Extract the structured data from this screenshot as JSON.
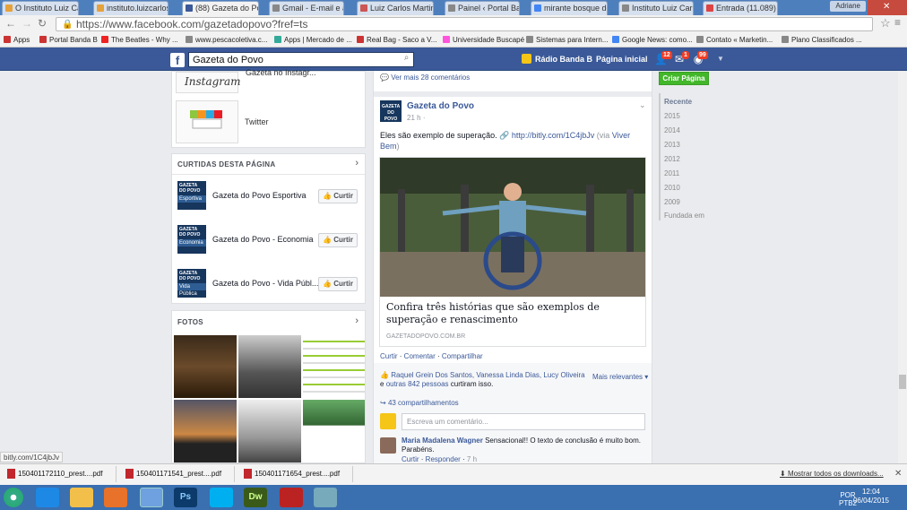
{
  "browser": {
    "tabs": [
      {
        "label": "O Instituto Luiz Ca",
        "color": "#e6a23c"
      },
      {
        "label": "instituto.luizcarlos",
        "color": "#e6a23c"
      },
      {
        "label": "(88) Gazeta do Po",
        "color": "#3b5998"
      },
      {
        "label": "Gmail - E-mail e ac",
        "color": "#888"
      },
      {
        "label": "Luiz Carlos Martin",
        "color": "#c55"
      },
      {
        "label": "Painel ‹ Portal Ban",
        "color": "#888"
      },
      {
        "label": "mirante bosque do",
        "color": "#4285f4"
      },
      {
        "label": "Instituto Luiz Carlo",
        "color": "#888"
      },
      {
        "label": "Entrada (11.089) -",
        "color": "#d44"
      }
    ],
    "user": "Adriane",
    "url": "https://www.facebook.com/gazetadopovo?fref=ts",
    "bookmarks": [
      "Apps",
      "Portal Banda B",
      "The Beatles - Why ...",
      "www.pescacoletiva.c...",
      "Apps | Mercado de ...",
      "Real Bag - Saco a V...",
      "Universidade Buscapé",
      "Sistemas para Intern...",
      "Google News: como...",
      "Contato « Marketin...",
      "Plano Classificados ..."
    ]
  },
  "fb": {
    "logo": "f",
    "search_value": "Gazeta do Povo",
    "nav_radio": "Rádio Banda B",
    "nav_home": "Página inicial",
    "badge_friends": "12",
    "badge_messages": "1",
    "badge_notifications": "99"
  },
  "left": {
    "instagram_label": "Instagram",
    "instagram_sub": "Gazeta no Instagr...",
    "twitter_label": "Twitter",
    "liked_title": "CURTIDAS DESTA PÁGINA",
    "liked_pages": [
      {
        "name": "Gazeta do Povo Esportiva",
        "thumb_top": "GAZETA DO POVO",
        "thumb_strip": "Esportiva"
      },
      {
        "name": "Gazeta do Povo - Economia",
        "thumb_top": "GAZETA DO POVO",
        "thumb_strip": "Economia"
      },
      {
        "name": "Gazeta do Povo - Vida Públ...",
        "thumb_top": "GAZETA DO POVO",
        "thumb_strip": "Vida Pública"
      }
    ],
    "curtir_label": "Curtir",
    "photos_title": "FOTOS"
  },
  "post": {
    "more_comments": "Ver mais 28 comentários",
    "page_name": "Gazeta do Povo",
    "avatar_text": "GAZETA DO POVO",
    "time": "21 h",
    "text_prefix": "Eles são exemplo de superação.",
    "link_url": "http://bitly.com/1C4jbJv",
    "via_open": "(via",
    "via_name": "Viver Bem",
    "via_close": ")",
    "link_title": "Confira três histórias que são exemplos de superação e renascimento",
    "link_domain": "GAZETADOPOVO.COM.BR",
    "action_like": "Curtir",
    "action_comment": "Comentar",
    "action_share": "Compartilhar",
    "likers": "Raquel Grein Dos Santos, Vanessa Linda Dias, Lucy Oliveira",
    "likers_and": "e",
    "likers_others": "outras 842 pessoas",
    "likers_suffix": "curtiram isso.",
    "sort_label": "Mais relevantes",
    "shares": "43 compartilhamentos",
    "comment_placeholder": "Escreva um comentário...",
    "comment_author": "Maria Madalena Wagner",
    "comment_text": "Sensacional!! O texto de conclusão é muito bom. Parabéns.",
    "comment_like": "Curtir",
    "comment_reply": "Responder",
    "comment_time": "7 h"
  },
  "right": {
    "create_page": "Criar Página",
    "years": [
      "Recente",
      "2015",
      "2014",
      "2013",
      "2012",
      "2011",
      "2010",
      "2009",
      "Fundada em"
    ]
  },
  "status_url": "bitly.com/1C4jbJv",
  "downloads": [
    "150401172110_prest....pdf",
    "150401171541_prest....pdf",
    "150401171654_prest....pdf"
  ],
  "show_all_downloads": "Mostrar todos os downloads...",
  "tray": {
    "lang": "POR",
    "layout": "PTB2",
    "time": "12:04",
    "date": "06/04/2015"
  },
  "colors": {
    "fb_blue": "#3b5998",
    "green_button": "#42b72a"
  }
}
